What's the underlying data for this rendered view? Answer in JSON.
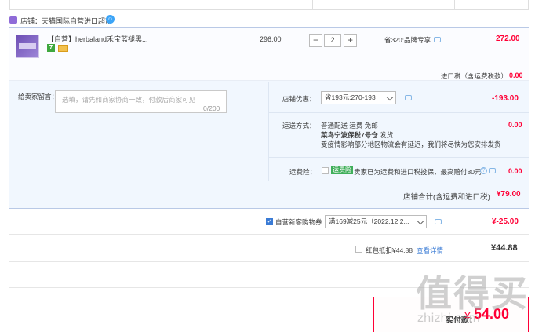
{
  "store": {
    "name": "店铺：天猫国际自营进口超市",
    "chat_icon": "chat-icon"
  },
  "item": {
    "title": "【自营】herbaland禾宝蓝褪黑...",
    "badge": "7",
    "price": "296.00",
    "qty_minus": "−",
    "qty": "2",
    "qty_plus": "+",
    "promo": "省320:品牌专享",
    "subtotal": "272.00"
  },
  "tax": {
    "label": "进口税（含运费税款）",
    "value": "0.00"
  },
  "message": {
    "label": "给卖家留言：",
    "placeholder": "选填，请先和商家协商一致，付款后商家可见",
    "count": "0/200"
  },
  "discount": {
    "label": "店铺优惠：",
    "selected": "省193元:270-193",
    "value": "-193.00"
  },
  "shipping": {
    "label": "运送方式：",
    "line1": "普通配送 运费 免邮",
    "line2_bold": "菜鸟宁波保税7号仓",
    "line2_rest": "发货",
    "line3": "受疫情影响部分地区物流会有延迟，我们将尽快为您安排发货",
    "value": "0.00"
  },
  "insurance": {
    "label": "运费险：",
    "badge": "运费险",
    "text": "卖家已为运费和进口税投保，最高赔付80元",
    "value": "0.00"
  },
  "store_total": {
    "label": "店铺合计(含运费和进口税)",
    "value": "¥79.00"
  },
  "coupon": {
    "label": "自营新客购物券",
    "selected": "满169减25元（2022.12.2...",
    "value": "¥-25.00"
  },
  "hongbao": {
    "label": "红包抵扣¥44.88",
    "link": "查看详情",
    "value": "¥44.88"
  },
  "pay": {
    "label": "实付款：",
    "yen": "¥",
    "value": "54.00"
  },
  "watermark": {
    "main": "值得买",
    "sub": "zhizhi.com"
  },
  "colors": {
    "accent_red": "#ff0036",
    "accent_blue": "#3a7bd5",
    "option_bg": "#f1f7fe"
  }
}
